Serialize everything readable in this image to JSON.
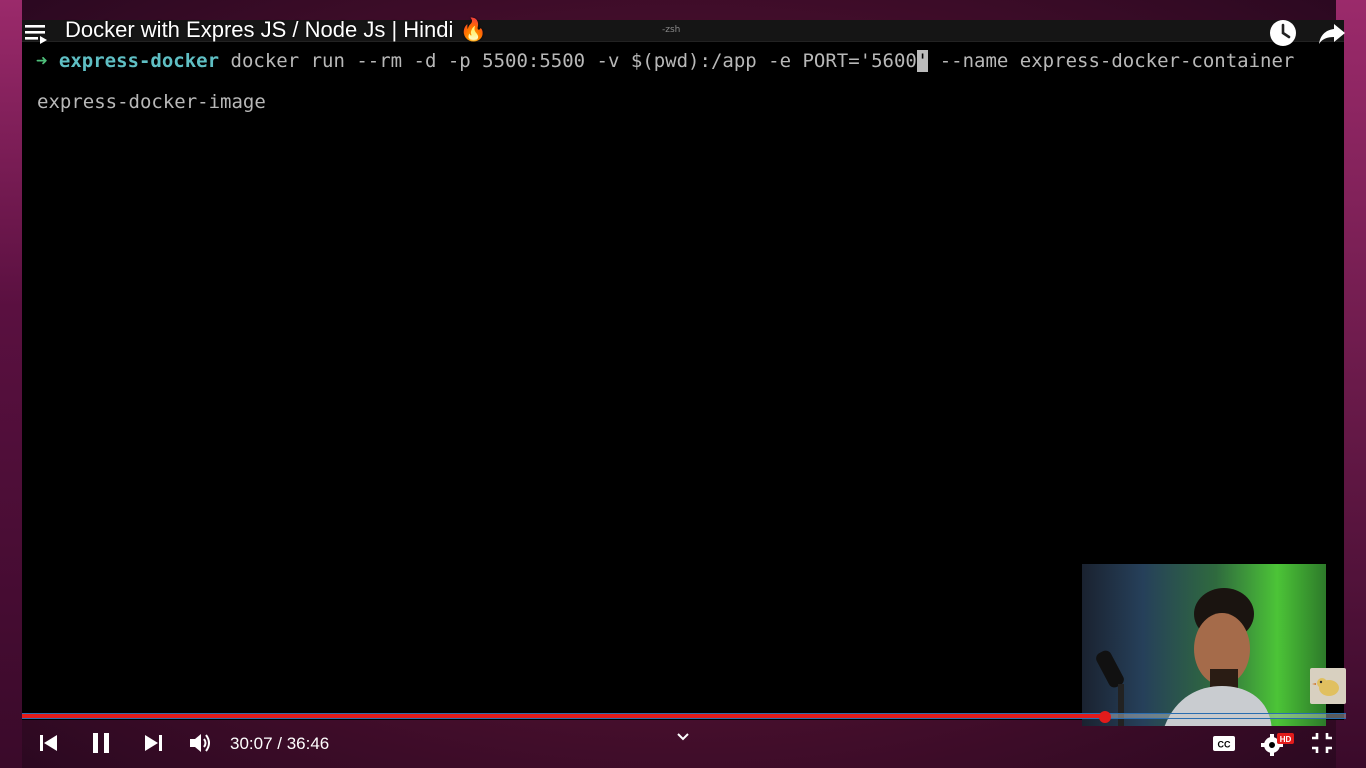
{
  "video": {
    "title": "Docker with Expres JS / Node Js | Hindi 🔥",
    "current_time": "30:07",
    "duration": "36:46",
    "time_display": "30:07 / 36:46",
    "progress_fraction": 0.818,
    "hd_badge": "HD"
  },
  "terminal": {
    "tab_title": "-zsh",
    "prompt_arrow": "➜",
    "prompt_dir": "express-docker",
    "command_before_cursor": " docker run --rm -d -p 5500:5500 -v $(pwd):/app -e PORT='5600",
    "cursor_char": "'",
    "command_after_cursor": " --name express-docker-container",
    "command_wrap": "express-docker-image"
  },
  "icons": {
    "playlist": "playlist-icon",
    "clock": "watch-later-icon",
    "share": "share-icon",
    "prev": "previous-icon",
    "pause": "pause-icon",
    "next": "next-icon",
    "volume": "volume-icon",
    "chevron": "chevron-down-icon",
    "captions": "captions-icon",
    "settings": "settings-icon",
    "exit_fullscreen": "exit-fullscreen-icon"
  },
  "colors": {
    "progress": "#e21b1b",
    "prompt_arrow": "#4ec07b",
    "prompt_dir": "#5fbfc4",
    "hd_badge": "#e21b1b"
  }
}
